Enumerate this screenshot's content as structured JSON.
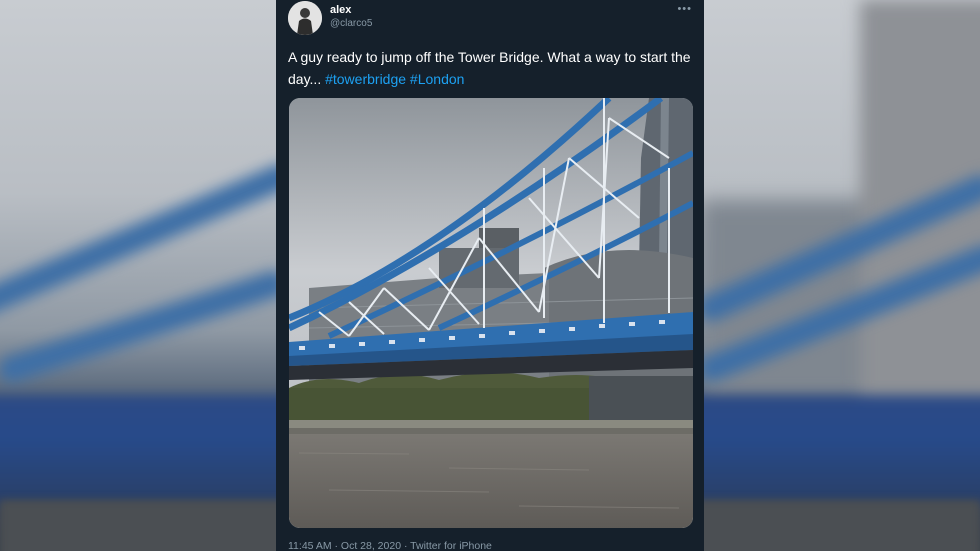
{
  "tweet": {
    "display_name": "alex",
    "verified_icon": "apple-icon",
    "handle": "@clarco5",
    "more_icon": "more-icon",
    "text_before": "A guy ready to jump off the Tower Bridge. What a way to start the day... ",
    "hashtag_1": "#towerbridge",
    "hashtag_2": "#London",
    "timestamp": "11:45 AM · Oct 28, 2020 · Twitter for iPhone"
  },
  "colors": {
    "card_background": "#15202b",
    "hashtag": "#1da1f2",
    "secondary_text": "#8899a6",
    "bridge_blue": "#2f6fb0"
  }
}
